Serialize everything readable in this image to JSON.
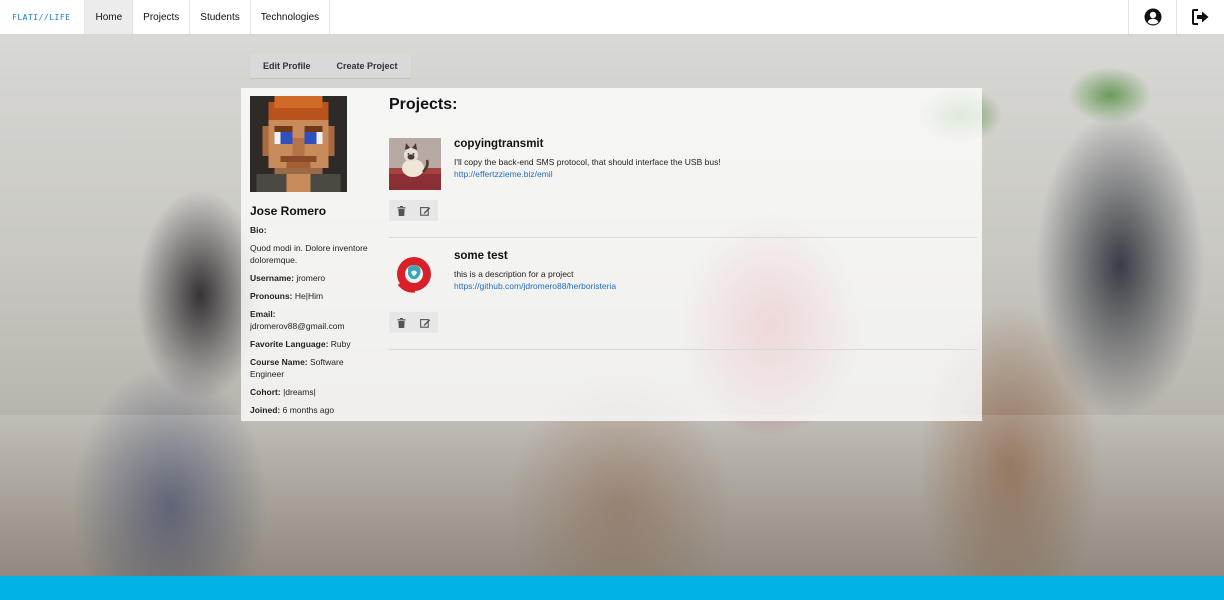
{
  "nav": {
    "logo_text": "FLATI//LIFE",
    "links": [
      "Home",
      "Projects",
      "Students",
      "Technologies"
    ],
    "active_index": 0,
    "profile_icon": "user-circle-icon",
    "logout_icon": "sign-out-icon"
  },
  "actions": {
    "edit_profile": "Edit Profile",
    "create_project": "Create Project"
  },
  "profile": {
    "name": "Jose Romero",
    "bio_label": "Bio:",
    "bio_text": "Quod modi in. Dolore inventore doloremque.",
    "username_label": "Username:",
    "username": "jromero",
    "pronouns_label": "Pronouns:",
    "pronouns": "He|Him",
    "email_label": "Email:",
    "email": "jdromerov88@gmail.com",
    "language_label": "Favorite Language:",
    "language": "Ruby",
    "course_label": "Course Name:",
    "course": "Software Engineer",
    "cohort_label": "Cohort:",
    "cohort": "|dreams|",
    "joined_label": "Joined:",
    "joined": "6 months ago"
  },
  "projects": {
    "title": "Projects:",
    "items": [
      {
        "name": "copyingtransmit",
        "description": "I'll copy the back-end SMS protocol, that should interface the USB bus!",
        "url": "http://effertzzieme.biz/emil",
        "thumb": "cat-photo"
      },
      {
        "name": "some test",
        "description": "this is a description for a project",
        "url": "https://github.com/jdromero88/herboristeria",
        "thumb": "red-flower-logo"
      }
    ],
    "delete_icon": "trash-icon",
    "edit_icon": "edit-icon"
  },
  "colors": {
    "accent": "#00b1e6",
    "link": "#1f6fbf",
    "logo": "#1b76c8"
  }
}
